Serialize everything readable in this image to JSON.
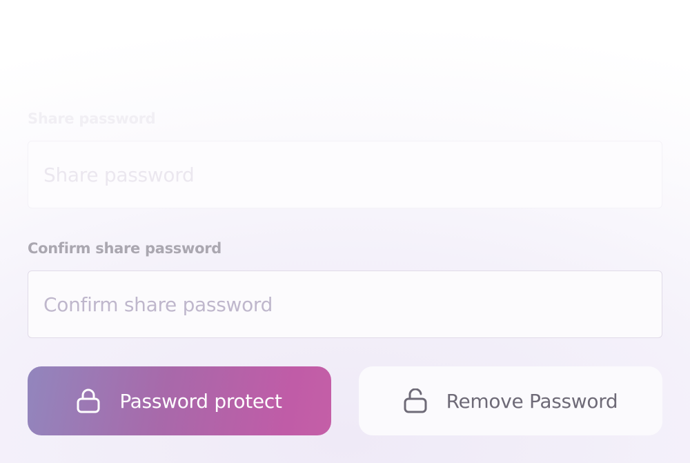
{
  "form": {
    "share_password": {
      "label": "Share password",
      "placeholder": "Share password",
      "value": ""
    },
    "confirm_password": {
      "label": "Confirm share password",
      "placeholder": "Confirm share password",
      "value": ""
    }
  },
  "actions": {
    "protect": {
      "label": "Password protect",
      "icon": "lock-icon"
    },
    "remove": {
      "label": "Remove Password",
      "icon": "unlock-icon"
    }
  },
  "colors": {
    "protect_gradient_start": "#9286bd",
    "protect_gradient_end": "#c45fa7",
    "remove_button_bg": "#fbfafd",
    "label_text": "#aaa7b0"
  }
}
